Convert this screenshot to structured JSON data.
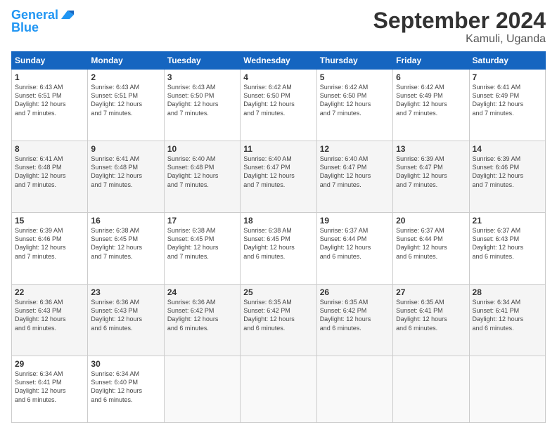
{
  "header": {
    "logo_line1": "General",
    "logo_line2": "Blue",
    "title": "September 2024",
    "subtitle": "Kamuli, Uganda"
  },
  "weekdays": [
    "Sunday",
    "Monday",
    "Tuesday",
    "Wednesday",
    "Thursday",
    "Friday",
    "Saturday"
  ],
  "weeks": [
    [
      {
        "day": "1",
        "info": "Sunrise: 6:43 AM\nSunset: 6:51 PM\nDaylight: 12 hours\nand 7 minutes."
      },
      {
        "day": "2",
        "info": "Sunrise: 6:43 AM\nSunset: 6:51 PM\nDaylight: 12 hours\nand 7 minutes."
      },
      {
        "day": "3",
        "info": "Sunrise: 6:43 AM\nSunset: 6:50 PM\nDaylight: 12 hours\nand 7 minutes."
      },
      {
        "day": "4",
        "info": "Sunrise: 6:42 AM\nSunset: 6:50 PM\nDaylight: 12 hours\nand 7 minutes."
      },
      {
        "day": "5",
        "info": "Sunrise: 6:42 AM\nSunset: 6:50 PM\nDaylight: 12 hours\nand 7 minutes."
      },
      {
        "day": "6",
        "info": "Sunrise: 6:42 AM\nSunset: 6:49 PM\nDaylight: 12 hours\nand 7 minutes."
      },
      {
        "day": "7",
        "info": "Sunrise: 6:41 AM\nSunset: 6:49 PM\nDaylight: 12 hours\nand 7 minutes."
      }
    ],
    [
      {
        "day": "8",
        "info": "Sunrise: 6:41 AM\nSunset: 6:48 PM\nDaylight: 12 hours\nand 7 minutes."
      },
      {
        "day": "9",
        "info": "Sunrise: 6:41 AM\nSunset: 6:48 PM\nDaylight: 12 hours\nand 7 minutes."
      },
      {
        "day": "10",
        "info": "Sunrise: 6:40 AM\nSunset: 6:48 PM\nDaylight: 12 hours\nand 7 minutes."
      },
      {
        "day": "11",
        "info": "Sunrise: 6:40 AM\nSunset: 6:47 PM\nDaylight: 12 hours\nand 7 minutes."
      },
      {
        "day": "12",
        "info": "Sunrise: 6:40 AM\nSunset: 6:47 PM\nDaylight: 12 hours\nand 7 minutes."
      },
      {
        "day": "13",
        "info": "Sunrise: 6:39 AM\nSunset: 6:47 PM\nDaylight: 12 hours\nand 7 minutes."
      },
      {
        "day": "14",
        "info": "Sunrise: 6:39 AM\nSunset: 6:46 PM\nDaylight: 12 hours\nand 7 minutes."
      }
    ],
    [
      {
        "day": "15",
        "info": "Sunrise: 6:39 AM\nSunset: 6:46 PM\nDaylight: 12 hours\nand 7 minutes."
      },
      {
        "day": "16",
        "info": "Sunrise: 6:38 AM\nSunset: 6:45 PM\nDaylight: 12 hours\nand 7 minutes."
      },
      {
        "day": "17",
        "info": "Sunrise: 6:38 AM\nSunset: 6:45 PM\nDaylight: 12 hours\nand 7 minutes."
      },
      {
        "day": "18",
        "info": "Sunrise: 6:38 AM\nSunset: 6:45 PM\nDaylight: 12 hours\nand 6 minutes."
      },
      {
        "day": "19",
        "info": "Sunrise: 6:37 AM\nSunset: 6:44 PM\nDaylight: 12 hours\nand 6 minutes."
      },
      {
        "day": "20",
        "info": "Sunrise: 6:37 AM\nSunset: 6:44 PM\nDaylight: 12 hours\nand 6 minutes."
      },
      {
        "day": "21",
        "info": "Sunrise: 6:37 AM\nSunset: 6:43 PM\nDaylight: 12 hours\nand 6 minutes."
      }
    ],
    [
      {
        "day": "22",
        "info": "Sunrise: 6:36 AM\nSunset: 6:43 PM\nDaylight: 12 hours\nand 6 minutes."
      },
      {
        "day": "23",
        "info": "Sunrise: 6:36 AM\nSunset: 6:43 PM\nDaylight: 12 hours\nand 6 minutes."
      },
      {
        "day": "24",
        "info": "Sunrise: 6:36 AM\nSunset: 6:42 PM\nDaylight: 12 hours\nand 6 minutes."
      },
      {
        "day": "25",
        "info": "Sunrise: 6:35 AM\nSunset: 6:42 PM\nDaylight: 12 hours\nand 6 minutes."
      },
      {
        "day": "26",
        "info": "Sunrise: 6:35 AM\nSunset: 6:42 PM\nDaylight: 12 hours\nand 6 minutes."
      },
      {
        "day": "27",
        "info": "Sunrise: 6:35 AM\nSunset: 6:41 PM\nDaylight: 12 hours\nand 6 minutes."
      },
      {
        "day": "28",
        "info": "Sunrise: 6:34 AM\nSunset: 6:41 PM\nDaylight: 12 hours\nand 6 minutes."
      }
    ],
    [
      {
        "day": "29",
        "info": "Sunrise: 6:34 AM\nSunset: 6:41 PM\nDaylight: 12 hours\nand 6 minutes."
      },
      {
        "day": "30",
        "info": "Sunrise: 6:34 AM\nSunset: 6:40 PM\nDaylight: 12 hours\nand 6 minutes."
      },
      {
        "day": "",
        "info": ""
      },
      {
        "day": "",
        "info": ""
      },
      {
        "day": "",
        "info": ""
      },
      {
        "day": "",
        "info": ""
      },
      {
        "day": "",
        "info": ""
      }
    ]
  ]
}
